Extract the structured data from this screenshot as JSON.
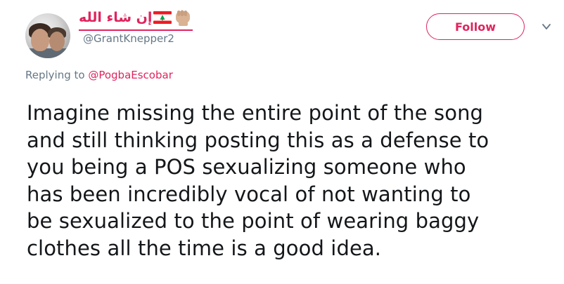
{
  "author": {
    "display_name": "إن شاء الله",
    "handle": "@GrantKnepper2",
    "emoji": [
      "lebanon-flag",
      "raised-fist-medium-skin-tone"
    ],
    "accent_color": "#e0245e"
  },
  "actions": {
    "follow_label": "Follow"
  },
  "reply": {
    "prefix": "Replying to ",
    "mention": "@PogbaEscobar"
  },
  "tweet": {
    "lines": [
      "Imagine missing the entire point of the song",
      "and still thinking posting this as a defense to",
      "you being a POS sexualizing someone who",
      "has been incredibly vocal of not wanting to",
      "be sexualized to the point of wearing baggy",
      "clothes all the time is a good idea."
    ]
  }
}
